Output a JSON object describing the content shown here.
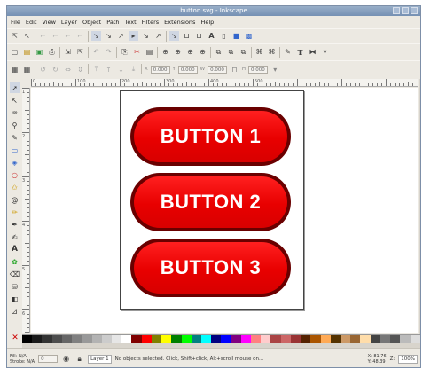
{
  "window": {
    "title": "button.svg - Inkscape"
  },
  "menu": [
    "File",
    "Edit",
    "View",
    "Layer",
    "Object",
    "Path",
    "Text",
    "Filters",
    "Extensions",
    "Help"
  ],
  "toolbar": {
    "field_x": "0.000",
    "field_y": "0.000",
    "field_w": "0.000",
    "field_h": "0.000"
  },
  "canvas": {
    "buttons": [
      "BUTTON 1",
      "BUTTON 2",
      "BUTTON 3"
    ],
    "button_fill": "#e80000",
    "button_stroke": "#6a0000"
  },
  "ruler_top": [
    "0",
    "100",
    "200",
    "300",
    "400",
    "500"
  ],
  "ruler_left": [
    "100",
    "200",
    "300",
    "400",
    "500",
    "600"
  ],
  "palette": [
    "#000000",
    "#1a1a1a",
    "#333333",
    "#4d4d4d",
    "#666666",
    "#808080",
    "#999999",
    "#b3b3b3",
    "#cccccc",
    "#e6e6e6",
    "#ffffff",
    "#800000",
    "#ff0000",
    "#808000",
    "#ffff00",
    "#008000",
    "#00ff00",
    "#008080",
    "#00ffff",
    "#000080",
    "#0000ff",
    "#800080",
    "#ff00ff",
    "#ff8080",
    "#ffcccc",
    "#aa4444",
    "#cc6666",
    "#993333",
    "#552200",
    "#aa5500",
    "#ffaa55",
    "#553300",
    "#cc9966",
    "#996633",
    "#ffddaa",
    "#444444",
    "#777777",
    "#555555",
    "#bbbbbb",
    "#dddddd"
  ],
  "status": {
    "fill_label": "Fill:",
    "fill_value": "N/A",
    "stroke_label": "Stroke:",
    "stroke_value": "N/A",
    "opacity": "0",
    "layer": "Layer 1",
    "message": "No objects selected. Click, Shift+click, Alt+scroll mouse on...",
    "x_label": "X:",
    "x_value": "81.76",
    "y_label": "Y:",
    "y_value": "48.39",
    "zoom_label": "Z:",
    "zoom_value": "100%"
  }
}
